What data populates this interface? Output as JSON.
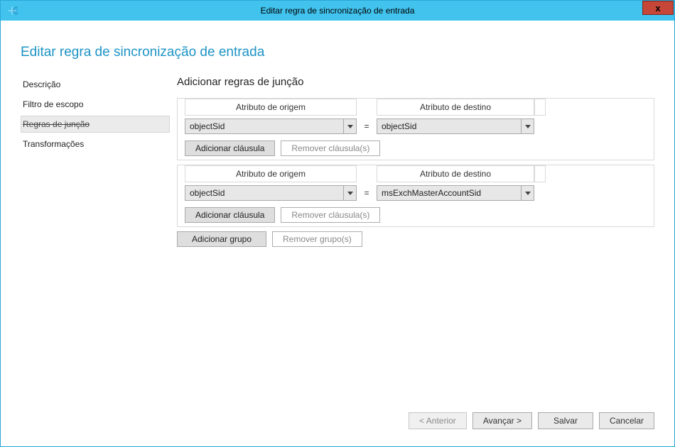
{
  "window": {
    "title": "Editar regra de sincronização de entrada"
  },
  "page": {
    "heading": "Editar regra de sincronização de entrada"
  },
  "sidebar": {
    "items": [
      {
        "label": "Descrição"
      },
      {
        "label": "Filtro de escopo"
      },
      {
        "label": "Regras de junção"
      },
      {
        "label": "Transformações"
      }
    ],
    "active_index": 2
  },
  "main": {
    "section_title": "Adicionar regras de junção",
    "columns": {
      "source_label": "Atributo de origem",
      "target_label": "Atributo de destino",
      "eq": "="
    },
    "groups": [
      {
        "source_value": "objectSid",
        "target_value": "objectSid",
        "add_clause_label": "Adicionar cláusula",
        "remove_clause_label": "Remover cláusula(s)"
      },
      {
        "source_value": "objectSid",
        "target_value": "msExchMasterAccountSid",
        "add_clause_label": "Adicionar cláusula",
        "remove_clause_label": "Remover cláusula(s)"
      }
    ],
    "add_group_label": "Adicionar grupo",
    "remove_group_label": "Remover grupo(s)"
  },
  "footer": {
    "back_label": "< Anterior",
    "next_label": "Avançar >",
    "save_label": "Salvar",
    "cancel_label": "Cancelar"
  }
}
